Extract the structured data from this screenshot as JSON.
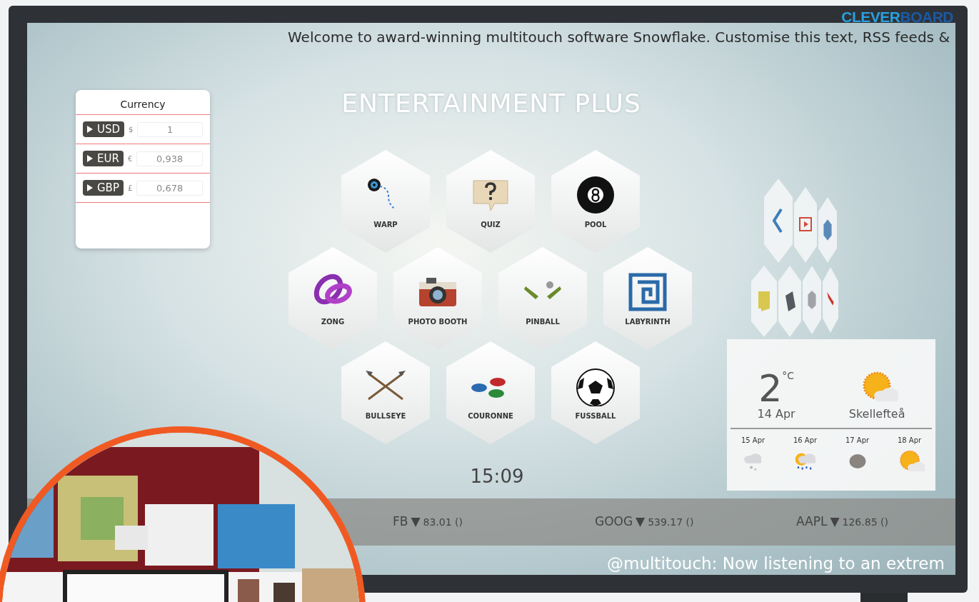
{
  "brand": {
    "first": "CLEVER",
    "second": "BOARD"
  },
  "ticker_top": "Welcome to award-winning multitouch software Snowflake. Customise this text, RSS feeds &",
  "currency": {
    "title": "Currency",
    "rows": [
      {
        "code": "USD",
        "symbol": "$",
        "value": "1"
      },
      {
        "code": "EUR",
        "symbol": "€",
        "value": "0,938"
      },
      {
        "code": "GBP",
        "symbol": "£",
        "value": "0,678"
      }
    ]
  },
  "title": "ENTERTAINMENT PLUS",
  "apps": [
    {
      "label": "WARP",
      "kind": "warp"
    },
    {
      "label": "QUIZ",
      "kind": "quiz"
    },
    {
      "label": "POOL",
      "kind": "pool"
    },
    {
      "label": "ZONG",
      "kind": "zong"
    },
    {
      "label": "PHOTO BOOTH",
      "kind": "camera"
    },
    {
      "label": "PINBALL",
      "kind": "pinball"
    },
    {
      "label": "LABYRINTH",
      "kind": "labyrinth"
    },
    {
      "label": "BULLSEYE",
      "kind": "arrows"
    },
    {
      "label": "COURONNE",
      "kind": "couronne"
    },
    {
      "label": "FUSSBALL",
      "kind": "football"
    }
  ],
  "side_tiles": [
    {
      "kind": "share"
    },
    {
      "kind": "video"
    },
    {
      "kind": "gem"
    },
    {
      "kind": "note"
    },
    {
      "kind": "slab"
    },
    {
      "kind": "grey"
    },
    {
      "kind": "pen"
    }
  ],
  "clock": "15:09",
  "weather": {
    "temp": "2",
    "unit": "°C",
    "date": "14 Apr",
    "city": "Skellefteå",
    "kind": "suncloud",
    "forecast": [
      {
        "date": "15 Apr",
        "kind": "snow"
      },
      {
        "date": "16 Apr",
        "kind": "rainsun"
      },
      {
        "date": "17 Apr",
        "kind": "overcast"
      },
      {
        "date": "18 Apr",
        "kind": "suncloud"
      }
    ]
  },
  "stocks": [
    {
      "symbol": "FB",
      "arrow": "▼",
      "value": "83.01 ()"
    },
    {
      "symbol": "GOOG",
      "arrow": "▼",
      "value": "539.17 ()"
    },
    {
      "symbol": "AAPL",
      "arrow": "▼",
      "value": "126.85 ()"
    }
  ],
  "ticker_bottom": "@multitouch: Now listening to an extrem"
}
